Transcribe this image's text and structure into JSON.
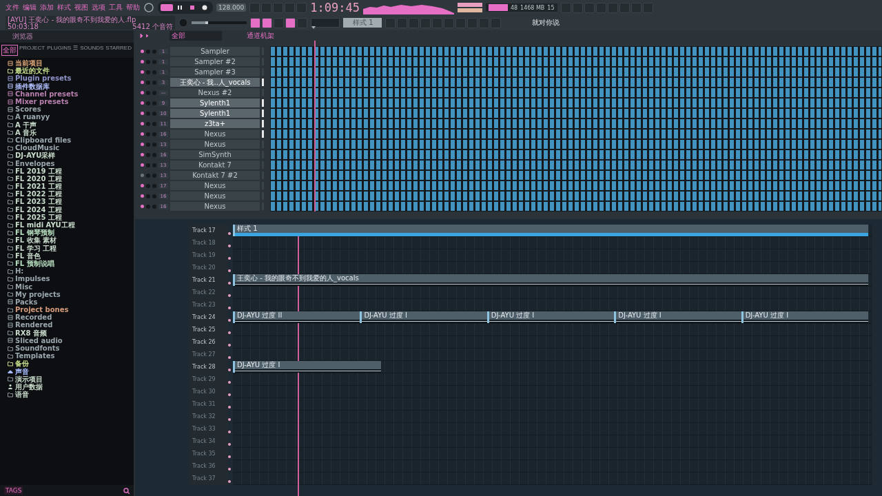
{
  "menu": [
    "文件",
    "编辑",
    "添加",
    "样式",
    "视图",
    "选项",
    "工具",
    "帮助"
  ],
  "transport": {
    "song_mode": true,
    "master_pitch": {
      "level": 0.3
    },
    "playing": true,
    "tempo": "128.000",
    "time": "1:09:45"
  },
  "monitor": {
    "cpu": "48",
    "memory": "1468 MB",
    "polyphony": "15"
  },
  "song": {
    "file": "[AYU] 王奕心 - 我的眼奇不到我爱的人.flp",
    "length": "50:03:18",
    "notes": "5412 个音符"
  },
  "pattern": {
    "name": "样式 1"
  },
  "hint": "就对你说",
  "browser": {
    "title": "浏览器",
    "footer": "TAGS",
    "tabs": [
      {
        "label": "全部",
        "selected": true
      },
      {
        "label": "PROJECT",
        "selected": false
      },
      {
        "label": "PLUGINS",
        "selected": false
      },
      {
        "label": "☰",
        "selected": false
      },
      {
        "label": "SOUNDS",
        "selected": false
      },
      {
        "label": "STARRED",
        "selected": false
      }
    ],
    "items": [
      {
        "label": "当前项目",
        "kind": "project",
        "color": "#e0a878"
      },
      {
        "label": "最近的文件",
        "kind": "recent",
        "color": "#c8e08c"
      },
      {
        "label": "Plugin presets",
        "kind": "plugin",
        "color": "#8e93c8"
      },
      {
        "label": "插件数据库",
        "kind": "plugin",
        "color": "#b4c2ff"
      },
      {
        "label": "Channel presets",
        "kind": "preset",
        "color": "#b77fae"
      },
      {
        "label": "Mixer presets",
        "kind": "mixer",
        "color": "#b77fae"
      },
      {
        "label": "Scores",
        "kind": "score",
        "color": "#9aa7ad"
      },
      {
        "label": "A ruanyy",
        "kind": "folder",
        "color": "#9aa7ad"
      },
      {
        "label": "A 干声",
        "kind": "folder",
        "color": "#c9dccb"
      },
      {
        "label": "A 音乐",
        "kind": "folder",
        "color": "#c9dccb"
      },
      {
        "label": "Clipboard files",
        "kind": "folder",
        "color": "#9aa7ad"
      },
      {
        "label": "CloudMusic",
        "kind": "folder",
        "color": "#9aa7ad"
      },
      {
        "label": "DJ-AYU采样",
        "kind": "folder",
        "color": "#c9dccb"
      },
      {
        "label": "Envelopes",
        "kind": "folder",
        "color": "#9aa7ad"
      },
      {
        "label": "FL 2019 工程",
        "kind": "folder",
        "color": "#c9dccb"
      },
      {
        "label": "FL 2020 工程",
        "kind": "folder",
        "color": "#c9dccb"
      },
      {
        "label": "FL 2021 工程",
        "kind": "folder",
        "color": "#c9dccb"
      },
      {
        "label": "FL 2022 工程",
        "kind": "folder",
        "color": "#c9dccb"
      },
      {
        "label": "FL 2023 工程",
        "kind": "folder",
        "color": "#c9dccb"
      },
      {
        "label": "FL 2024 工程",
        "kind": "folder",
        "color": "#c9dccb"
      },
      {
        "label": "FL 2025 工程",
        "kind": "folder",
        "color": "#c9dccb"
      },
      {
        "label": "FL midi AYU工程",
        "kind": "folder",
        "color": "#c9dccb"
      },
      {
        "label": "FL 钢琴预制",
        "kind": "folder",
        "color": "#b8e0c0"
      },
      {
        "label": "FL 收集 素材",
        "kind": "folder",
        "color": "#c9dccb"
      },
      {
        "label": "FL 学习 工程",
        "kind": "folder",
        "color": "#c9dccb"
      },
      {
        "label": "FL 音色",
        "kind": "folder",
        "color": "#c9dccb"
      },
      {
        "label": "FL 预制说唱",
        "kind": "folder",
        "color": "#b8e0c0"
      },
      {
        "label": "H:",
        "kind": "folder",
        "color": "#9aa7ad"
      },
      {
        "label": "Impulses",
        "kind": "folder",
        "color": "#9aa7ad"
      },
      {
        "label": "Misc",
        "kind": "folder",
        "color": "#9aa7ad"
      },
      {
        "label": "My projects",
        "kind": "folder",
        "color": "#9aa7ad"
      },
      {
        "label": "Packs",
        "kind": "packs",
        "color": "#9aa7ad"
      },
      {
        "label": "Project bones",
        "kind": "folder",
        "color": "#d49a7a"
      },
      {
        "label": "Recorded",
        "kind": "recorded",
        "color": "#9aa7ad"
      },
      {
        "label": "Rendered",
        "kind": "recorded",
        "color": "#9aa7ad"
      },
      {
        "label": "RX8 音频",
        "kind": "folder",
        "color": "#c9dccb"
      },
      {
        "label": "Sliced audio",
        "kind": "recorded",
        "color": "#9aa7ad"
      },
      {
        "label": "Soundfonts",
        "kind": "folder",
        "color": "#9aa7ad"
      },
      {
        "label": "Templates",
        "kind": "folder",
        "color": "#9aa7ad"
      },
      {
        "label": "备份",
        "kind": "recent",
        "color": "#c8e08c"
      },
      {
        "label": "声音",
        "kind": "cloud",
        "color": "#a8bcff"
      },
      {
        "label": "演示项目",
        "kind": "folder",
        "color": "#c9dccb"
      },
      {
        "label": "用户数据",
        "kind": "user",
        "color": "#c9dccb"
      },
      {
        "label": "语音",
        "kind": "folder",
        "color": "#c9dccb"
      }
    ]
  },
  "channel_rack": {
    "title": "通道机架",
    "filter": "全部",
    "channels": [
      {
        "number": "1",
        "name": "Sampler",
        "muted": false,
        "selected": false,
        "active": false
      },
      {
        "number": "1",
        "name": "Sampler #2",
        "muted": false,
        "selected": false,
        "active": false
      },
      {
        "number": "1",
        "name": "Sampler #3",
        "muted": false,
        "selected": false,
        "active": false
      },
      {
        "number": "3",
        "name": "王奕心 - 我..人_vocals",
        "muted": false,
        "selected": true,
        "active": true
      },
      {
        "number": "—",
        "name": "Nexus #2",
        "muted": false,
        "selected": false,
        "active": false
      },
      {
        "number": "9",
        "name": "Sylenth1",
        "muted": false,
        "selected": true,
        "active": true
      },
      {
        "number": "10",
        "name": "Sylenth1",
        "muted": false,
        "selected": true,
        "active": true
      },
      {
        "number": "11",
        "name": "z3ta+",
        "muted": false,
        "selected": true,
        "active": true
      },
      {
        "number": "16",
        "name": "Nexus",
        "muted": false,
        "selected": false,
        "active": true
      },
      {
        "number": "13",
        "name": "Nexus",
        "muted": false,
        "selected": false,
        "active": false
      },
      {
        "number": "16",
        "name": "SimSynth",
        "muted": false,
        "selected": false,
        "active": false
      },
      {
        "number": "13",
        "name": "Kontakt 7",
        "muted": false,
        "selected": false,
        "active": false
      },
      {
        "number": "13",
        "name": "Kontakt 7 #2",
        "muted": true,
        "selected": false,
        "active": false
      },
      {
        "number": "17",
        "name": "Nexus",
        "muted": false,
        "selected": false,
        "active": false
      },
      {
        "number": "16",
        "name": "Nexus",
        "muted": false,
        "selected": false,
        "active": false
      },
      {
        "number": "16",
        "name": "Nexus",
        "muted": false,
        "selected": false,
        "active": false
      }
    ]
  },
  "playlist": {
    "tracks": [
      {
        "name": "Track 17",
        "empty": false,
        "clips": [
          {
            "label": "样式 1",
            "kind": "pattern"
          }
        ]
      },
      {
        "name": "Track 18",
        "empty": true
      },
      {
        "name": "Track 19",
        "empty": true
      },
      {
        "name": "Track 20",
        "empty": true
      },
      {
        "name": "Track 21",
        "empty": false,
        "clips": [
          {
            "label": "王奕心 - 我的眼奇不到我爱的人_vocals",
            "kind": "audio"
          }
        ]
      },
      {
        "name": "Track 22",
        "empty": true
      },
      {
        "name": "Track 23",
        "empty": true
      },
      {
        "name": "Track 24",
        "empty": false,
        "clips": [
          {
            "label": "DJ-AYU 过度 II",
            "kind": "audio"
          },
          {
            "label": "DJ-AYU 过度 I",
            "kind": "audio"
          },
          {
            "label": "DJ-AYU 过度 I",
            "kind": "audio"
          },
          {
            "label": "DJ-AYU 过度 I",
            "kind": "audio"
          },
          {
            "label": "DJ-AYU 过度 I",
            "kind": "audio"
          }
        ]
      },
      {
        "name": "Track 25",
        "empty": false
      },
      {
        "name": "Track 26",
        "empty": false
      },
      {
        "name": "Track 27",
        "empty": true
      },
      {
        "name": "Track 28",
        "empty": false,
        "clips": [
          {
            "label": "DJ-AYU 过度 I",
            "kind": "short-audio"
          }
        ]
      },
      {
        "name": "Track 29",
        "empty": true
      },
      {
        "name": "Track 30",
        "empty": true
      },
      {
        "name": "Track 31",
        "empty": true
      },
      {
        "name": "Track 32",
        "empty": true
      },
      {
        "name": "Track 33",
        "empty": true
      },
      {
        "name": "Track 34",
        "empty": true
      },
      {
        "name": "Track 35",
        "empty": true
      },
      {
        "name": "Track 36",
        "empty": true
      },
      {
        "name": "Track 37",
        "empty": true
      }
    ]
  }
}
